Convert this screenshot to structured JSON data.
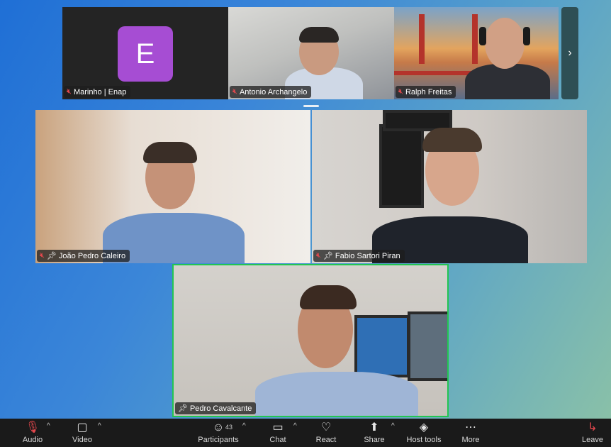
{
  "thumbnails": [
    {
      "name": "Marinho | Enap",
      "avatar_letter": "E",
      "muted": true
    },
    {
      "name": "Antonio Archangelo",
      "muted": true
    },
    {
      "name": "Ralph Freitas",
      "muted": true
    }
  ],
  "thumb_next_icon": "chevron-right-icon",
  "tiles": [
    {
      "name": "João Pedro Caleiro",
      "muted": true,
      "pinned": true
    },
    {
      "name": "Fabio Sartori Piran",
      "muted": true,
      "pinned": true
    },
    {
      "name": "Pedro Cavalcante",
      "muted": false,
      "pinned": true,
      "active_speaker": true
    }
  ],
  "toolbar": {
    "audio_label": "Audio",
    "video_label": "Video",
    "participants_label": "Participants",
    "participants_count": "43",
    "chat_label": "Chat",
    "react_label": "React",
    "share_label": "Share",
    "host_tools_label": "Host tools",
    "more_label": "More",
    "leave_label": "Leave"
  },
  "colors": {
    "active_speaker_border": "#23c552",
    "muted_icon": "#e5484d",
    "avatar_bg": "#a64dd3",
    "toolbar_bg": "#1a1a1a"
  }
}
